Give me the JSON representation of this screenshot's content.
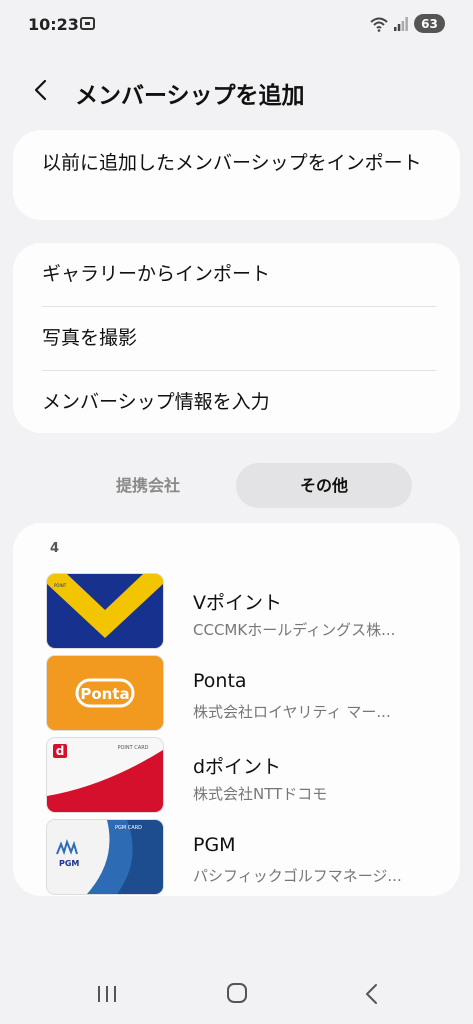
{
  "status": {
    "time": "10:23",
    "battery": "63"
  },
  "header": {
    "title": "メンバーシップを追加"
  },
  "import_previous": {
    "label": "以前に追加したメンバーシップをインポート"
  },
  "options": [
    {
      "label": "ギャラリーからインポート"
    },
    {
      "label": "写真を撮影"
    },
    {
      "label": "メンバーシップ情報を入力"
    }
  ],
  "tabs": [
    {
      "label": "提携会社",
      "selected": false
    },
    {
      "label": "その他",
      "selected": true
    }
  ],
  "list": {
    "count": "4",
    "items": [
      {
        "name": "Vポイント",
        "company": "CCCMKホールディングス株..."
      },
      {
        "name": "Ponta",
        "company": "株式会社ロイヤリティ マー..."
      },
      {
        "name": "dポイント",
        "company": "株式会社NTTドコモ"
      },
      {
        "name": "PGM",
        "company": "パシフィックゴルフマネージ..."
      }
    ]
  },
  "cards": {
    "vpoint_text": "POINT",
    "ponta_text": "Ponta",
    "dpoint_letter": "d",
    "dpoint_text": "POINT CARD",
    "pgm_header": "PGM CARD",
    "pgm_text": "PGM"
  },
  "colors": {
    "background": "#f2f2f4",
    "card": "#fdfdfd",
    "selected_tab": "#e3e3e5",
    "vpoint_yellow": "#f3c400",
    "vpoint_blue": "#17318f",
    "ponta_orange": "#f29a1f",
    "dpoint_red": "#d5102c",
    "pgm_blue": "#2d6cb5"
  }
}
